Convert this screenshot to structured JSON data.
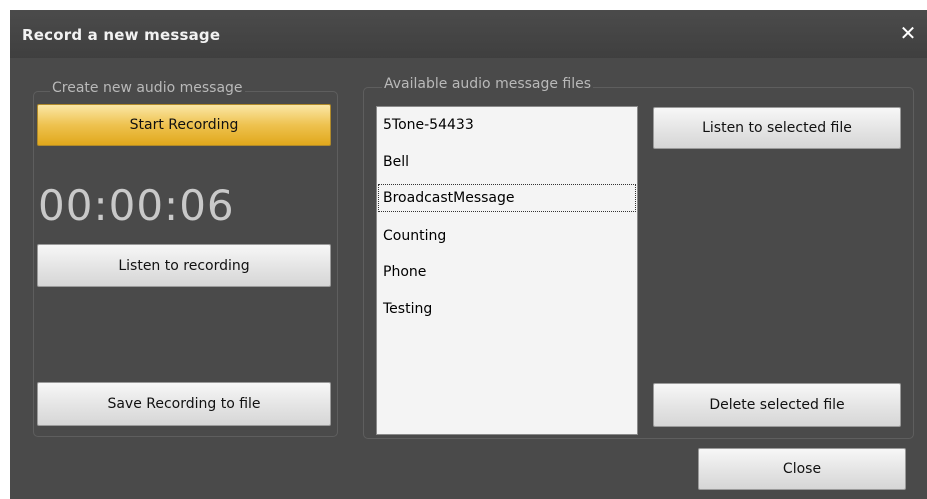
{
  "dialog": {
    "title": "Record a new message",
    "close_icon": "close-icon"
  },
  "create_group": {
    "label": "Create new audio message",
    "start_recording_label": "Start Recording",
    "timer": "00:00:06",
    "listen_recording_label": "Listen to recording",
    "save_recording_label": "Save Recording to file"
  },
  "files_group": {
    "label": "Available audio message files",
    "items": [
      "5Tone-54433",
      "Bell",
      "BroadcastMessage",
      "Counting",
      "Phone",
      "Testing"
    ],
    "focused_item": "BroadcastMessage",
    "listen_selected_label": "Listen to selected file",
    "delete_selected_label": "Delete selected file"
  },
  "footer": {
    "close_label": "Close"
  },
  "colors": {
    "dialog_bg": "#4a4a4a",
    "primary_button": "#eec24f",
    "timer_text": "#c9c9c9"
  }
}
